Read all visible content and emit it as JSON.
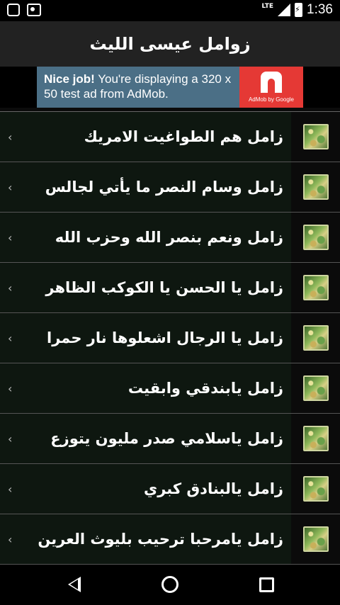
{
  "status_bar": {
    "network": "LTE",
    "time": "1:36",
    "left_icons": [
      "gallery-icon",
      "media-icon"
    ]
  },
  "app_bar": {
    "title": "زوامل عيسى الليث"
  },
  "ad": {
    "headline_bold": "Nice job!",
    "headline_rest": " You're displaying a 320 x 50 test ad from AdMob.",
    "logo_caption": "AdMob by Google",
    "accent": "#e53935",
    "background": "#4b6f86"
  },
  "list": {
    "items": [
      {
        "title": "زامل هم الطواغيت الامريك",
        "icon": "zamel-thumbnail"
      },
      {
        "title": "زامل وسام النصر ما يأتي لجالس",
        "icon": "zamel-thumbnail"
      },
      {
        "title": "زامل ونعم بنصر الله وحزب الله",
        "icon": "zamel-thumbnail"
      },
      {
        "title": "زامل يا الحسن يا الكوكب الظاهر",
        "icon": "zamel-thumbnail"
      },
      {
        "title": "زامل يا الرجال اشعلوها نار حمرا",
        "icon": "zamel-thumbnail"
      },
      {
        "title": "زامل يابندقي وابقيت",
        "icon": "zamel-thumbnail"
      },
      {
        "title": "زامل ياسلامي صدر مليون يتوزع",
        "icon": "zamel-thumbnail"
      },
      {
        "title": "زامل يالبنادق كبري",
        "icon": "zamel-thumbnail"
      },
      {
        "title": "زامل يامرحبا ترحيب بليوث العرين",
        "icon": "zamel-thumbnail"
      }
    ],
    "chevron": "‹"
  },
  "nav_bar": {
    "icons": [
      "back-icon",
      "home-icon",
      "recents-icon"
    ]
  }
}
